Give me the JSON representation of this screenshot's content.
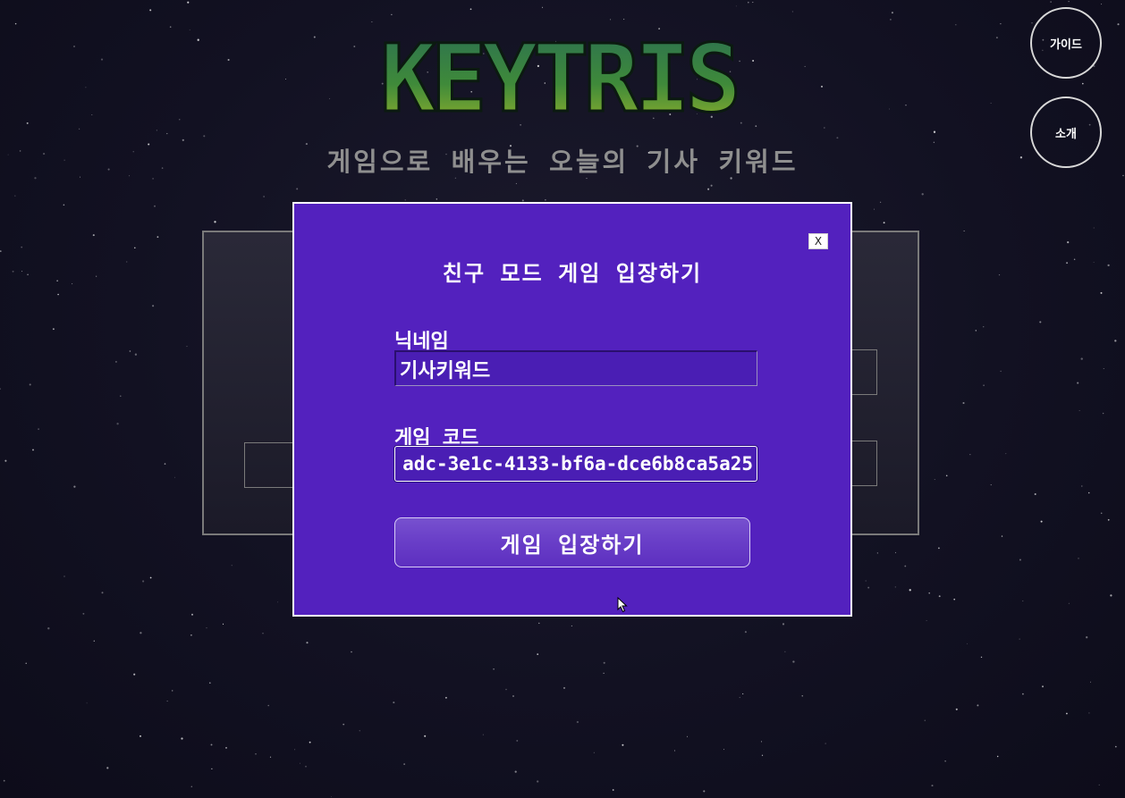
{
  "app": {
    "logo_text": "KEYTRIS",
    "subtitle": "게임으로 배우는 오늘의 기사 키워드"
  },
  "side_buttons": {
    "guide_label": "가이드",
    "about_label": "소개"
  },
  "modal": {
    "close_label": "X",
    "title": "친구 모드 게임 입장하기",
    "nickname_label": "닉네임",
    "nickname_value": "기사키워드",
    "game_code_label": "게임 코드",
    "game_code_value": "adc-3e1c-4133-bf6a-dce6b8ca5a25",
    "enter_button_label": "게임 입장하기"
  },
  "colors": {
    "modal_bg": "#5321be",
    "logo_green": "#2f7d4a",
    "logo_yellow": "#9fb22c",
    "background": "#121122"
  },
  "icons": {
    "cursor": "mouse-pointer-icon"
  }
}
